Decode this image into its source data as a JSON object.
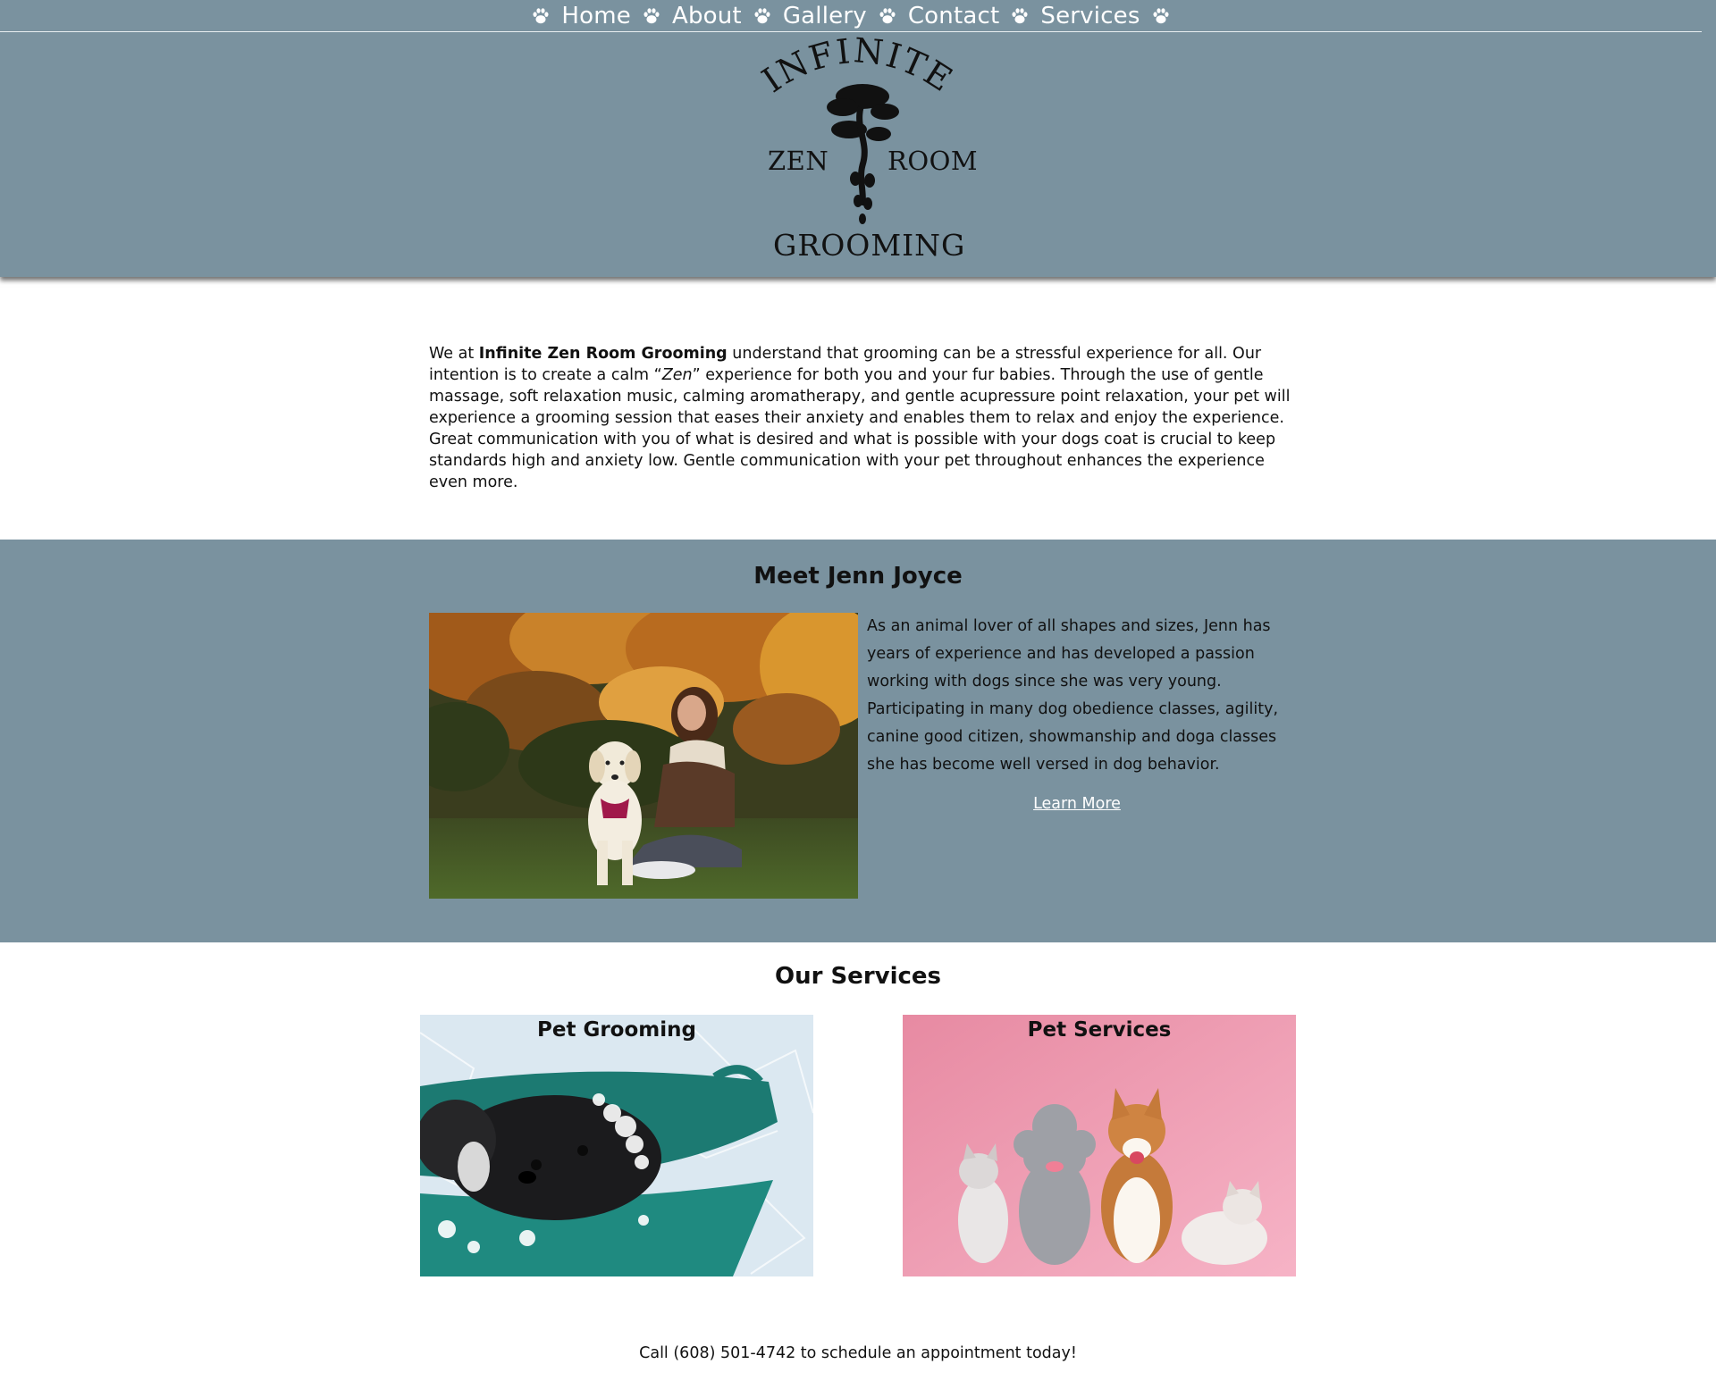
{
  "nav": {
    "items": [
      "Home",
      "About",
      "Gallery",
      "Contact",
      "Services"
    ]
  },
  "logo": {
    "top": "INFINITE",
    "left": "ZEN",
    "right": "ROOM",
    "bottom": "GROOMING"
  },
  "intro": {
    "prefix": "We at ",
    "business_name": "Infinite Zen Room Grooming",
    "part1": " understand that grooming can be a stressful experience for all. Our intention is to create a calm “",
    "zen": "Zen",
    "part2": "” experience for both you and your fur babies. Through the use of gentle massage, soft relaxation music, calming aromatherapy, and gentle acupressure point relaxation, your pet will experience a grooming session that eases their anxiety and enables them to relax and enjoy the experience. Great communication with you of what is desired and what is possible with your dogs coat is crucial to keep standards high and anxiety low. Gentle communication with your pet throughout enhances the experience even more."
  },
  "meet": {
    "title": "Meet Jenn Joyce",
    "bio": "As an animal lover of all shapes and sizes, Jenn has years of experience and has developed a passion working with dogs since she was very young. Participating in many dog obedience classes, agility, canine good citizen, showmanship and doga classes she has become well versed in dog behavior.",
    "learn_more": "Learn More"
  },
  "services": {
    "title": "Our Services",
    "cards": [
      {
        "title": "Pet Grooming"
      },
      {
        "title": "Pet Services"
      }
    ]
  },
  "footer": {
    "call": "Call (608) 501-4742 to schedule an appointment today!"
  },
  "colors": {
    "header_bg": "#7a929f",
    "nav_text": "#ffffff",
    "services_pink": "#f2a3b8"
  }
}
